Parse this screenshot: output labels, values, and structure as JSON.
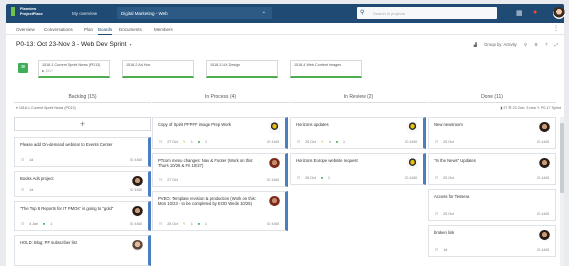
{
  "topbar": {
    "logo_line1": "Planview",
    "logo_line2": "ProjectPlace",
    "nav_overview": "My overview",
    "project": "Digital Marketing - Web",
    "search_placeholder": "Search in projects"
  },
  "tabs": [
    {
      "label": "Overview"
    },
    {
      "label": "Conversations"
    },
    {
      "label": "Plan"
    },
    {
      "label": "Boards"
    },
    {
      "label": "Documents"
    },
    {
      "label": "Members"
    }
  ],
  "sprint": {
    "title": "P0-13: Oct 23-Nov 3 - Web Dev Sprint",
    "group_by": "Group by: Activity",
    "boxes": [
      {
        "title": "1518-1 Current Sprint News (PD13)",
        "sub": "▶ 1517"
      },
      {
        "title": "1518-2 Ad Hoc",
        "sub": ""
      },
      {
        "title": "1518-3 UX Design",
        "sub": ""
      },
      {
        "title": "1518-4 Web Content Images",
        "sub": ""
      }
    ]
  },
  "columns": {
    "backlog": "Backlog (15)",
    "inprogress": "In Process (4)",
    "inreview": "In Review (2)",
    "done": "Done (11)"
  },
  "group_row": {
    "label": "1518-1 Current Sprint News (PD13)",
    "stats": "▮ 27  ☰ 23 Ooh: 3 new  ✎ P0-17 Sprint"
  },
  "cards": {
    "backlog": [
      {
        "title": "Please add On-demand webinar to Events Center",
        "meta1": "1d",
        "id": "ID 4468"
      },
      {
        "title": "Books Ads project",
        "meta1": "1d",
        "id": "ID 4468"
      },
      {
        "title": "\"The Top 8 Reports for IT PMOs\" is going to \"gold\"",
        "meta1": "4 Jan",
        "meta2": "1",
        "id": "ID 4468"
      },
      {
        "title": "HOLD: Blog: PF subscriber list",
        "meta1": "",
        "id": ""
      }
    ],
    "inprogress": [
      {
        "title": "Copy of Spirit PFPFF image Prep Work",
        "meta1": "27 Oct",
        "meta2": "1",
        "meta3": "1",
        "id": "ID 4468"
      },
      {
        "title": "PTcom menu changes: Nav & Footer (Work on this: Thurs 10/26 & Fri 10/27)",
        "meta1": "27 Oct",
        "id": "ID 4468"
      },
      {
        "title": "PVEO: Template revision & production (Work on this: Mon 10/23 - to be completed by EOD Weds 10/25)",
        "meta1": "25 Oct",
        "meta2": "1",
        "meta3": "1",
        "id": "ID 4468"
      }
    ],
    "inreview": [
      {
        "title": "Horizons updates",
        "meta1": "20 Oct",
        "meta2": "4",
        "meta3": "1",
        "id": "ID 4468"
      },
      {
        "title": "Horizons Europe website request",
        "meta1": "26 Oct",
        "meta2": "1",
        "id": "ID 4468"
      }
    ],
    "done": [
      {
        "title": "New newsroom",
        "meta1": "25 Oct",
        "id": "ID 4468"
      },
      {
        "title": "\"In the News\" Updates",
        "meta1": "25 Oct",
        "id": "ID 4468"
      },
      {
        "title": "Access for Tessera",
        "meta1": "25 Oct",
        "id": "ID 4468"
      },
      {
        "title": "broken link",
        "meta1": "1d",
        "id": "ID 4468"
      }
    ]
  },
  "colors": {
    "topbar": "#1f4a73",
    "sprint_icon": "#3fae5a",
    "card_accent": "#4a7fbf"
  }
}
